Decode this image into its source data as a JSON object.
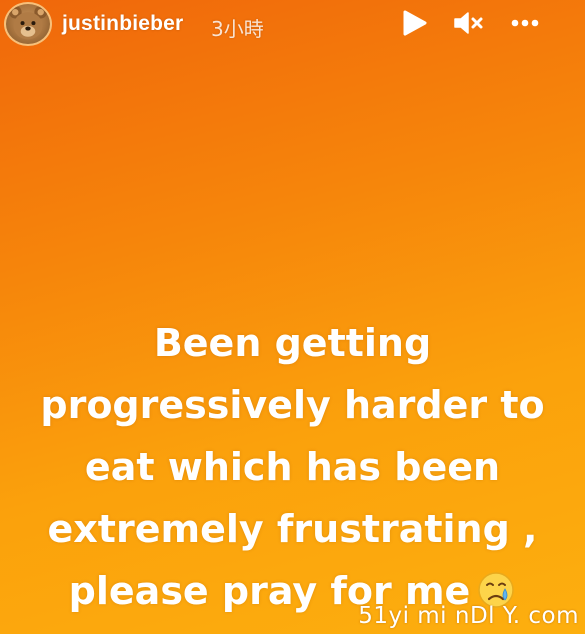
{
  "colors": {
    "background_top": "#f0670b",
    "background_bottom": "#fdaf0e",
    "text": "#ffffff"
  },
  "header": {
    "avatar_icon": "teddy-bear-avatar",
    "username": "justinbieber",
    "time_ago": "3小時",
    "controls": [
      {
        "name": "play-icon"
      },
      {
        "name": "mute-icon"
      },
      {
        "name": "more-icon"
      }
    ]
  },
  "story": {
    "lines": [
      "Been getting",
      "progressively harder to",
      "eat which has been",
      "extremely frustrating ,",
      "please pray for me"
    ],
    "emoji": "crying-face-emoji"
  },
  "watermark": "51yi mi nDl Y. com"
}
